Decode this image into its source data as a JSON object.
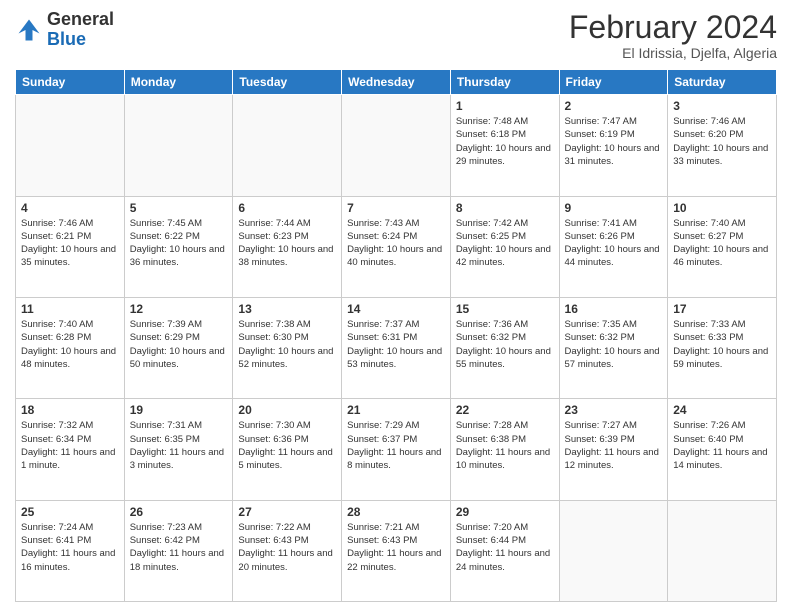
{
  "logo": {
    "general": "General",
    "blue": "Blue"
  },
  "header": {
    "title": "February 2024",
    "subtitle": "El Idrissia, Djelfa, Algeria"
  },
  "days_of_week": [
    "Sunday",
    "Monday",
    "Tuesday",
    "Wednesday",
    "Thursday",
    "Friday",
    "Saturday"
  ],
  "weeks": [
    [
      {
        "day": "",
        "info": ""
      },
      {
        "day": "",
        "info": ""
      },
      {
        "day": "",
        "info": ""
      },
      {
        "day": "",
        "info": ""
      },
      {
        "day": "1",
        "info": "Sunrise: 7:48 AM\nSunset: 6:18 PM\nDaylight: 10 hours and 29 minutes."
      },
      {
        "day": "2",
        "info": "Sunrise: 7:47 AM\nSunset: 6:19 PM\nDaylight: 10 hours and 31 minutes."
      },
      {
        "day": "3",
        "info": "Sunrise: 7:46 AM\nSunset: 6:20 PM\nDaylight: 10 hours and 33 minutes."
      }
    ],
    [
      {
        "day": "4",
        "info": "Sunrise: 7:46 AM\nSunset: 6:21 PM\nDaylight: 10 hours and 35 minutes."
      },
      {
        "day": "5",
        "info": "Sunrise: 7:45 AM\nSunset: 6:22 PM\nDaylight: 10 hours and 36 minutes."
      },
      {
        "day": "6",
        "info": "Sunrise: 7:44 AM\nSunset: 6:23 PM\nDaylight: 10 hours and 38 minutes."
      },
      {
        "day": "7",
        "info": "Sunrise: 7:43 AM\nSunset: 6:24 PM\nDaylight: 10 hours and 40 minutes."
      },
      {
        "day": "8",
        "info": "Sunrise: 7:42 AM\nSunset: 6:25 PM\nDaylight: 10 hours and 42 minutes."
      },
      {
        "day": "9",
        "info": "Sunrise: 7:41 AM\nSunset: 6:26 PM\nDaylight: 10 hours and 44 minutes."
      },
      {
        "day": "10",
        "info": "Sunrise: 7:40 AM\nSunset: 6:27 PM\nDaylight: 10 hours and 46 minutes."
      }
    ],
    [
      {
        "day": "11",
        "info": "Sunrise: 7:40 AM\nSunset: 6:28 PM\nDaylight: 10 hours and 48 minutes."
      },
      {
        "day": "12",
        "info": "Sunrise: 7:39 AM\nSunset: 6:29 PM\nDaylight: 10 hours and 50 minutes."
      },
      {
        "day": "13",
        "info": "Sunrise: 7:38 AM\nSunset: 6:30 PM\nDaylight: 10 hours and 52 minutes."
      },
      {
        "day": "14",
        "info": "Sunrise: 7:37 AM\nSunset: 6:31 PM\nDaylight: 10 hours and 53 minutes."
      },
      {
        "day": "15",
        "info": "Sunrise: 7:36 AM\nSunset: 6:32 PM\nDaylight: 10 hours and 55 minutes."
      },
      {
        "day": "16",
        "info": "Sunrise: 7:35 AM\nSunset: 6:32 PM\nDaylight: 10 hours and 57 minutes."
      },
      {
        "day": "17",
        "info": "Sunrise: 7:33 AM\nSunset: 6:33 PM\nDaylight: 10 hours and 59 minutes."
      }
    ],
    [
      {
        "day": "18",
        "info": "Sunrise: 7:32 AM\nSunset: 6:34 PM\nDaylight: 11 hours and 1 minute."
      },
      {
        "day": "19",
        "info": "Sunrise: 7:31 AM\nSunset: 6:35 PM\nDaylight: 11 hours and 3 minutes."
      },
      {
        "day": "20",
        "info": "Sunrise: 7:30 AM\nSunset: 6:36 PM\nDaylight: 11 hours and 5 minutes."
      },
      {
        "day": "21",
        "info": "Sunrise: 7:29 AM\nSunset: 6:37 PM\nDaylight: 11 hours and 8 minutes."
      },
      {
        "day": "22",
        "info": "Sunrise: 7:28 AM\nSunset: 6:38 PM\nDaylight: 11 hours and 10 minutes."
      },
      {
        "day": "23",
        "info": "Sunrise: 7:27 AM\nSunset: 6:39 PM\nDaylight: 11 hours and 12 minutes."
      },
      {
        "day": "24",
        "info": "Sunrise: 7:26 AM\nSunset: 6:40 PM\nDaylight: 11 hours and 14 minutes."
      }
    ],
    [
      {
        "day": "25",
        "info": "Sunrise: 7:24 AM\nSunset: 6:41 PM\nDaylight: 11 hours and 16 minutes."
      },
      {
        "day": "26",
        "info": "Sunrise: 7:23 AM\nSunset: 6:42 PM\nDaylight: 11 hours and 18 minutes."
      },
      {
        "day": "27",
        "info": "Sunrise: 7:22 AM\nSunset: 6:43 PM\nDaylight: 11 hours and 20 minutes."
      },
      {
        "day": "28",
        "info": "Sunrise: 7:21 AM\nSunset: 6:43 PM\nDaylight: 11 hours and 22 minutes."
      },
      {
        "day": "29",
        "info": "Sunrise: 7:20 AM\nSunset: 6:44 PM\nDaylight: 11 hours and 24 minutes."
      },
      {
        "day": "",
        "info": ""
      },
      {
        "day": "",
        "info": ""
      }
    ]
  ]
}
